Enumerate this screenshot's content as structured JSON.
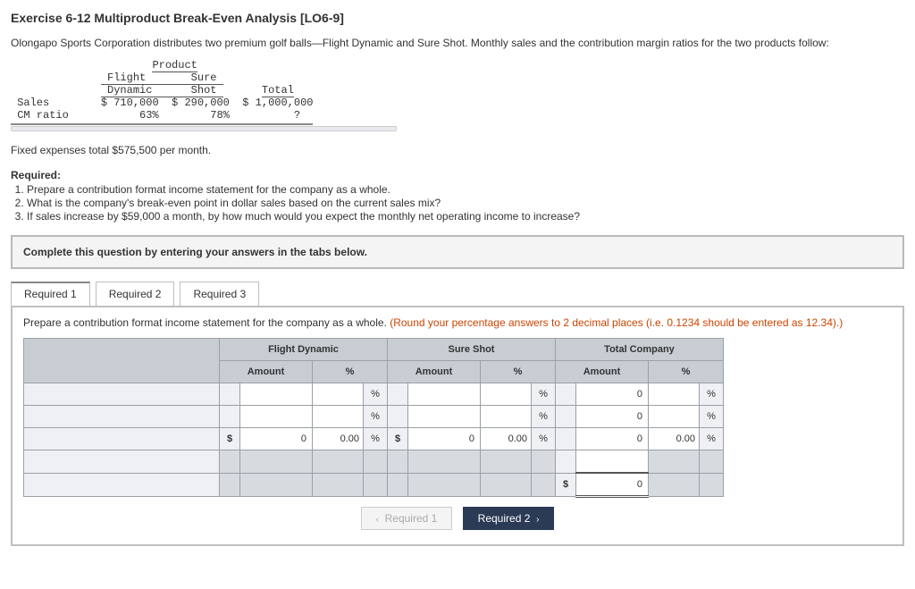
{
  "title": "Exercise 6-12 Multiproduct Break-Even Analysis [LO6-9]",
  "intro": "Olongapo Sports Corporation distributes two premium golf balls—Flight Dynamic and Sure Shot. Monthly sales and the contribution margin ratios for the two products follow:",
  "ptable": {
    "hdr_product": "Product",
    "col_fd1": "Flight",
    "col_fd2": "Dynamic",
    "col_ss1": "Sure",
    "col_ss2": "Shot",
    "col_total": "Total",
    "row_sales": "Sales",
    "row_cm": "CM ratio",
    "v_fd_sales": "$ 710,000",
    "v_ss_sales": "$ 290,000",
    "v_tot_sales": "$ 1,000,000",
    "v_fd_cm": "63%",
    "v_ss_cm": "78%",
    "v_tot_cm": "?"
  },
  "fixed_line": "Fixed expenses total $575,500 per month.",
  "required_hdr": "Required:",
  "required": [
    "Prepare a contribution format income statement for the company as a whole.",
    "What is the company's break-even point in dollar sales based on the current sales mix?",
    "If sales increase by $59,000 a month, by how much would you expect the monthly net operating income to increase?"
  ],
  "instruct": "Complete this question by entering your answers in the tabs below.",
  "tabs": {
    "t1": "Required 1",
    "t2": "Required 2",
    "t3": "Required 3"
  },
  "panel": {
    "prompt_main": "Prepare a contribution format income statement for the company as a whole. ",
    "prompt_hint": "(Round your percentage answers to 2 decimal places (i.e. 0.1234 should be entered as 12.34).)",
    "hdr_fd": "Flight Dynamic",
    "hdr_ss": "Sure Shot",
    "hdr_tot": "Total Company",
    "sub_amount": "Amount",
    "sub_pct": "%",
    "dollar": "$",
    "pct_sign": "%",
    "zero": "0",
    "zero_pct": "0.00"
  },
  "nav": {
    "prev": "Required 1",
    "next": "Required 2"
  }
}
